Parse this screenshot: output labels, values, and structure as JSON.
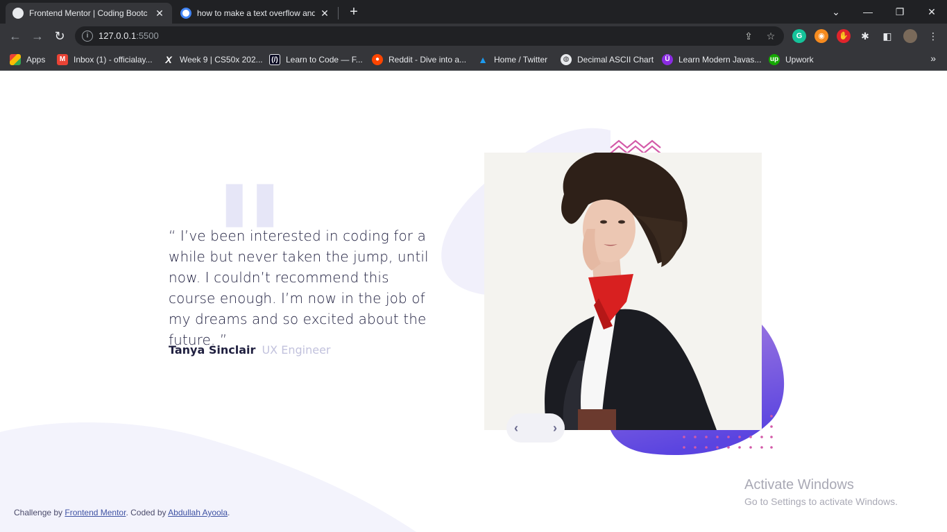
{
  "browser": {
    "tabs": [
      {
        "title": "Frontend Mentor | Coding Bootc",
        "active": true
      },
      {
        "title": "how to make a text overflow and",
        "active": false
      }
    ],
    "new_tab": "+",
    "url_host": "127.0.0.1",
    "url_port": ":5500",
    "bookmarks": [
      {
        "label": "Apps",
        "color": "#4285f4"
      },
      {
        "label": "Inbox (1) - officialay...",
        "color": "#ea4335"
      },
      {
        "label": "Week 9 | CS50x 202...",
        "color": "#000000"
      },
      {
        "label": "Learn to Code — F...",
        "color": "#0a0a23"
      },
      {
        "label": "Reddit - Dive into a...",
        "color": "#ff4500"
      },
      {
        "label": "Home / Twitter",
        "color": "#1d9bf0"
      },
      {
        "label": "Decimal ASCII Chart",
        "color": "#5f6368"
      },
      {
        "label": "Learn Modern Javas...",
        "color": "#8a2be2"
      },
      {
        "label": "Upwork",
        "color": "#14a800"
      }
    ]
  },
  "testimonial": {
    "quote": "“ I’ve been interested in coding for a while but never taken the jump, until now. I couldn’t recommend this course enough. I’m now in the job of my dreams and so excited about the future. ”",
    "name": "Tanya Sinclair",
    "role": "UX Engineer"
  },
  "footer": {
    "prefix": "Challenge by ",
    "link1": "Frontend Mentor",
    "middle": ". Coded by ",
    "link2": "Abdullah Ayoola",
    "suffix": "."
  },
  "watermark": {
    "line1": "Activate Windows",
    "line2": "Go to Settings to activate Windows."
  },
  "colors": {
    "accent_purple": "#6a4ee0",
    "accent_pink": "#e05cc0",
    "text_dark": "#202040",
    "text_muted": "#c2c2dd"
  }
}
